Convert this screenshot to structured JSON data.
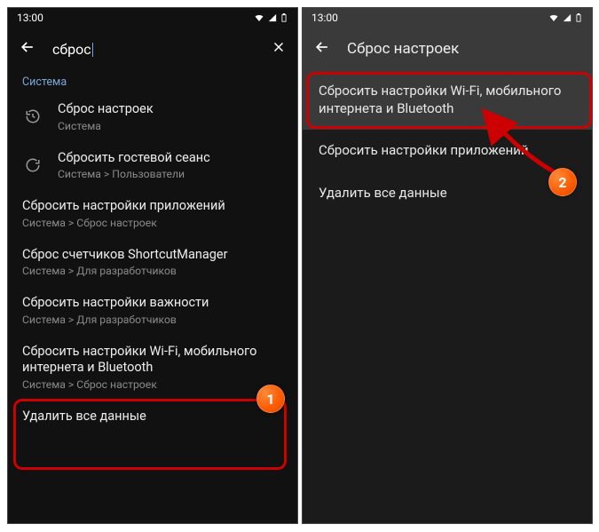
{
  "status_time": "13:00",
  "left": {
    "search_text": "сброс",
    "section": "Система",
    "items": [
      {
        "title": "Сброс настроек",
        "subtitle": "Система",
        "icon": "history"
      },
      {
        "title": "Сбросить гостевой сеанс",
        "subtitle": "Система > Пользователи",
        "icon": "refresh"
      },
      {
        "title": "Сбросить настройки приложений",
        "subtitle": "Система > Сброс настроек"
      },
      {
        "title": "Сброс счетчиков ShortcutManager",
        "subtitle": "Система > Для разработчиков"
      },
      {
        "title": "Сбросить настройки важности",
        "subtitle": "Система > Для разработчиков"
      },
      {
        "title": "Сбросить настройки Wi-Fi, мобильного интернета и Bluetooth",
        "subtitle": "Система > Сброс настроек"
      },
      {
        "title": "Удалить все данные"
      }
    ]
  },
  "right": {
    "heading": "Сброс настроек",
    "items": [
      "Сбросить настройки Wi-Fi, мобильного интернета и Bluetooth",
      "Сбросить настройки приложений",
      "Удалить все данные"
    ]
  },
  "badges": {
    "one": "1",
    "two": "2"
  }
}
